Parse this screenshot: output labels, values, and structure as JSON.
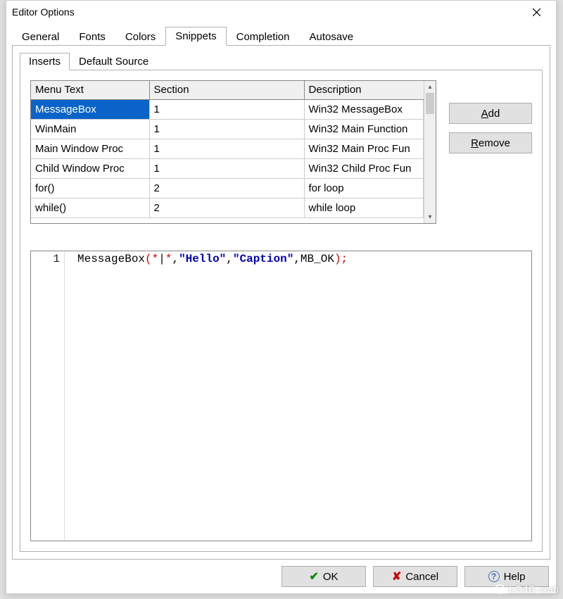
{
  "window": {
    "title": "Editor Options"
  },
  "tabs": {
    "items": [
      "General",
      "Fonts",
      "Colors",
      "Snippets",
      "Completion",
      "Autosave"
    ],
    "active": 3
  },
  "inner_tabs": {
    "items": [
      "Inserts",
      "Default Source"
    ],
    "active": 0
  },
  "table": {
    "headers": [
      "Menu Text",
      "Section",
      "Description"
    ],
    "rows": [
      {
        "menu": "MessageBox",
        "section": "1",
        "desc": "Win32 MessageBox",
        "selected": true
      },
      {
        "menu": "WinMain",
        "section": "1",
        "desc": "Win32 Main Function"
      },
      {
        "menu": "Main Window Proc",
        "section": "1",
        "desc": "Win32 Main Proc Fun"
      },
      {
        "menu": "Child Window Proc",
        "section": "1",
        "desc": "Win32 Child Proc Fun"
      },
      {
        "menu": "for()",
        "section": "2",
        "desc": "for loop"
      },
      {
        "menu": "while()",
        "section": "2",
        "desc": "while loop"
      }
    ]
  },
  "buttons": {
    "add": {
      "pre": "",
      "u": "A",
      "post": "dd"
    },
    "remove": {
      "pre": "",
      "u": "R",
      "post": "emove"
    }
  },
  "code": {
    "line_number": "1",
    "tokens": {
      "fn": "MessageBox",
      "open": "(",
      "star1": "*",
      "bar": "|",
      "star2": "*",
      "comma1": ",",
      "str1": "\"Hello\"",
      "comma2": ",",
      "str2": "\"Caption\"",
      "comma3": ",",
      "const": "MB_OK",
      "close": ")",
      "semi": ";"
    }
  },
  "footer": {
    "ok": "OK",
    "cancel": "Cancel",
    "help": "Help"
  },
  "watermark": "LO4D.com"
}
